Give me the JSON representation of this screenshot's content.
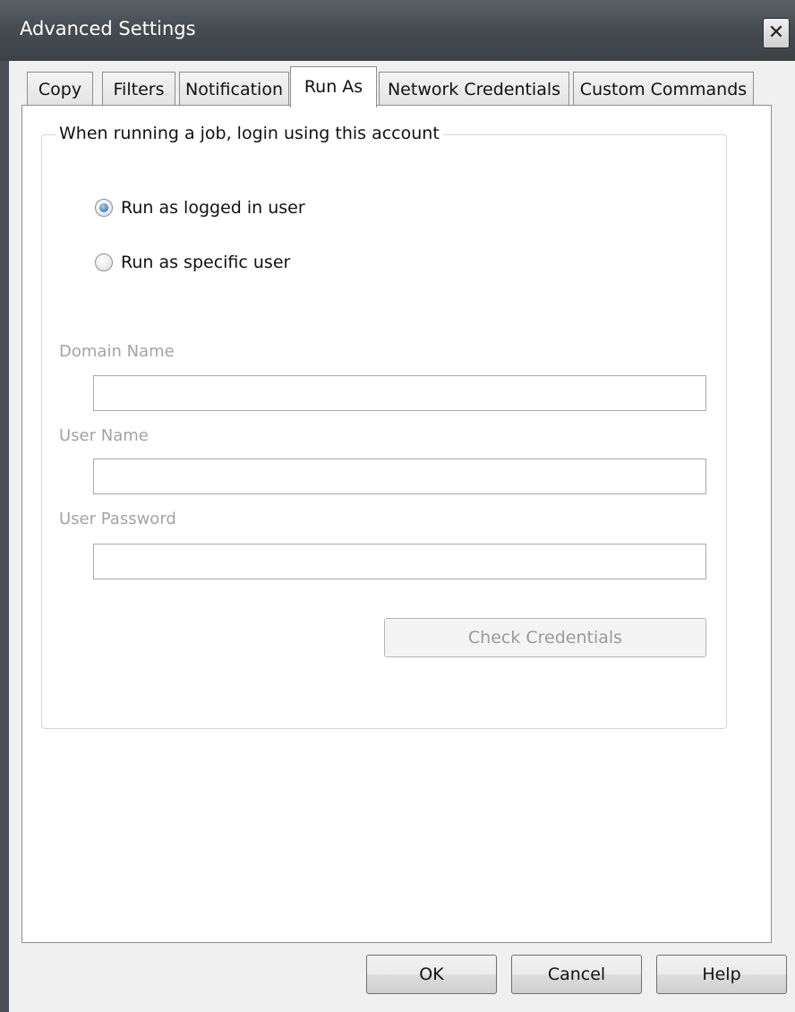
{
  "window": {
    "title": "Advanced Settings",
    "close_glyph": "✕"
  },
  "tabs": [
    {
      "label": "Copy"
    },
    {
      "label": "Filters"
    },
    {
      "label": "Notification"
    },
    {
      "label": "Run As",
      "active": true
    },
    {
      "label": "Network Credentials"
    },
    {
      "label": "Custom Commands"
    }
  ],
  "run_as": {
    "group_title": "When running a job, login using this account",
    "options": [
      {
        "label": "Run as logged in user",
        "checked": true
      },
      {
        "label": "Run as specific user",
        "checked": false
      }
    ],
    "domain_name_label": "Domain Name",
    "domain_name_value": "",
    "user_name_label": "User Name",
    "user_name_value": "",
    "user_password_label": "User Password",
    "user_password_value": "",
    "check_credentials_label": "Check Credentials"
  },
  "buttons": {
    "ok": "OK",
    "cancel": "Cancel",
    "help": "Help"
  },
  "colors": {
    "titlebar": "#474c52",
    "radio_selected": "#1c5a9a",
    "disabled_text": "#a3a3a3"
  },
  "icons": {
    "close": "close-icon",
    "radio": "radio-button-icon"
  }
}
